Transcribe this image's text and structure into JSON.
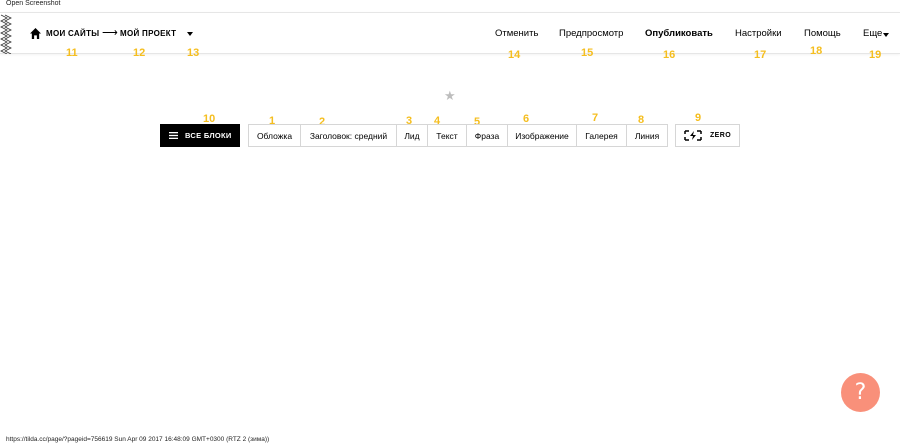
{
  "caption": "Open Screenshot",
  "header": {
    "breadcrumb": [
      "МОИ САЙТЫ",
      "МОЙ ПРОЕКТ"
    ],
    "breadcrumb_separator": "⟶",
    "nav": {
      "cancel": "Отменить",
      "preview": "Предпросмотр",
      "publish": "Опубликовать",
      "settings": "Настройки",
      "help": "Помощь",
      "more": "Еще"
    }
  },
  "toolbar": {
    "all_blocks": "ВСЕ БЛОКИ",
    "tabs": [
      "Обложка",
      "Заголовок: средний",
      "Лид",
      "Текст",
      "Фраза",
      "Изображение",
      "Галерея",
      "Линия"
    ],
    "zero": "ZERO"
  },
  "annotations": [
    "1",
    "2",
    "3",
    "4",
    "5",
    "6",
    "7",
    "8",
    "9",
    "10",
    "11",
    "12",
    "13",
    "14",
    "15",
    "16",
    "17",
    "18",
    "19"
  ],
  "help_button": "?",
  "status_url": "https://tilda.cc/page/?pageid=756619 Sun Apr 09 2017 16:48:09 GMT+0300 (RTZ 2 (зима))",
  "colors": {
    "annotation": "#f5be1f",
    "help_fab": "#f9907a",
    "primary": "#000000"
  },
  "icons": [
    "home-icon",
    "zigzag-logo-icon",
    "menu-icon",
    "zero-block-icon",
    "star-icon",
    "chevron-down-icon"
  ]
}
